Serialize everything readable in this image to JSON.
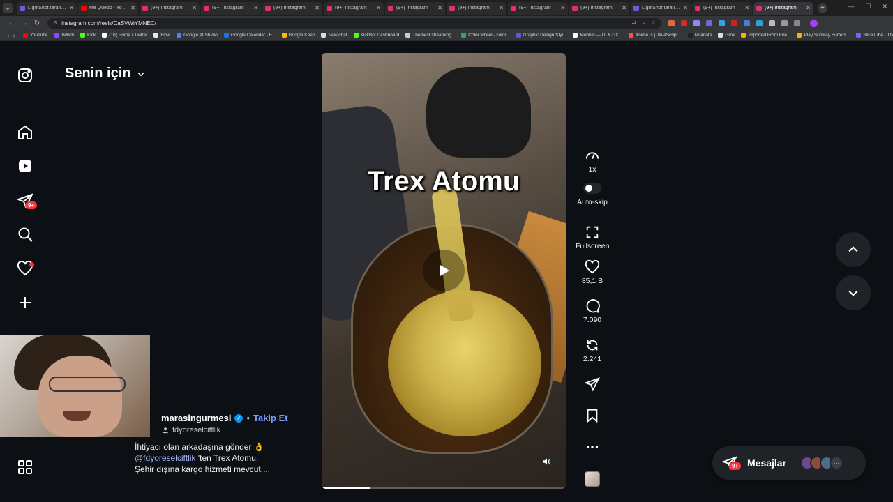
{
  "browser": {
    "tabs": [
      {
        "title": "LightShot tarafından",
        "color": "#6f5bd6"
      },
      {
        "title": "Me Quedo - YouTube",
        "color": "#ff0000"
      },
      {
        "title": "(9+) Instagram",
        "color": "#e1306c"
      },
      {
        "title": "(9+) Instagram",
        "color": "#e1306c"
      },
      {
        "title": "(9+) Instagram",
        "color": "#e1306c"
      },
      {
        "title": "(9+) Instagram",
        "color": "#e1306c"
      },
      {
        "title": "(9+) Instagram",
        "color": "#e1306c"
      },
      {
        "title": "(9+) Instagram",
        "color": "#e1306c"
      },
      {
        "title": "(9+) Instagram",
        "color": "#e1306c"
      },
      {
        "title": "(9+) Instagram",
        "color": "#e1306c"
      },
      {
        "title": "LightShot tarafından",
        "color": "#6f5bd6"
      },
      {
        "title": "(9+) Instagram",
        "color": "#e1306c"
      },
      {
        "title": "(9+) Instagram",
        "color": "#e1306c",
        "active": true
      }
    ],
    "url": "instagram.com/reels/DaSVWiYMNEC/",
    "bookmarks": [
      {
        "label": "YouTube",
        "color": "#ff0000"
      },
      {
        "label": "Twitch",
        "color": "#9146ff"
      },
      {
        "label": "Kick",
        "color": "#53fc18"
      },
      {
        "label": "(10) Home / Twitter",
        "color": "#ffffff"
      },
      {
        "label": "Flow",
        "color": "#e8e8e8"
      },
      {
        "label": "Google AI Studio",
        "color": "#4285f4"
      },
      {
        "label": "Google Calendar - F...",
        "color": "#1a73e8"
      },
      {
        "label": "Google Keep",
        "color": "#fbbc04"
      },
      {
        "label": "New chat",
        "color": "#dddddd"
      },
      {
        "label": "KickBot Dashboard",
        "color": "#53fc18"
      },
      {
        "label": "The best streaming...",
        "color": "#cccccc"
      },
      {
        "label": "Color wheel - color...",
        "color": "#34a853"
      },
      {
        "label": "Graphic Design Styl...",
        "color": "#5b5bd6"
      },
      {
        "label": "Mobbin — UI & UX...",
        "color": "#ffffff"
      },
      {
        "label": "Anime.js | JavaScript...",
        "color": "#ff4b4b"
      },
      {
        "label": "Milanote",
        "color": "#222222"
      },
      {
        "label": "Grok",
        "color": "#dddddd"
      },
      {
        "label": "Imported From Fire...",
        "color": "#f4b400"
      },
      {
        "label": "Play Subway Surfers...",
        "color": "#f4b400"
      },
      {
        "label": "SliceTube - The Fast...",
        "color": "#7b61ff"
      }
    ]
  },
  "sidebar": {
    "icons": [
      "instagram-icon",
      "home-icon",
      "reels-icon",
      "messages-icon",
      "search-icon",
      "notifications-icon",
      "create-icon",
      "profile-icon",
      "more-icon"
    ],
    "messages_badge": "9+"
  },
  "feed": {
    "title": "Senin için"
  },
  "video": {
    "overlay_text": "Trex Atomu",
    "progress": 0.2
  },
  "post": {
    "author": "marasingurmesi",
    "follow_label": "Takip Et",
    "collaborator": "fdyoreselciftlik",
    "caption_line1": "İhtiyacı olan arkadaşına gönder 👌",
    "caption_mention": "@fdyoreselciftlik",
    "caption_line2_rest": " 'ten Trex Atomu.",
    "caption_line3": "Şehir dışına kargo hizmeti mevcut...."
  },
  "actions": {
    "speed": "1x",
    "autoskip": "Auto-skip",
    "fullscreen": "Fullscreen",
    "likes": "85,1 B",
    "comments": "7.090",
    "reposts": "2.241"
  },
  "messages": {
    "label": "Mesajlar",
    "badge": "9+",
    "avatar_colors": [
      "#6a4b8c",
      "#8c4b3a",
      "#4b6a8c"
    ]
  }
}
